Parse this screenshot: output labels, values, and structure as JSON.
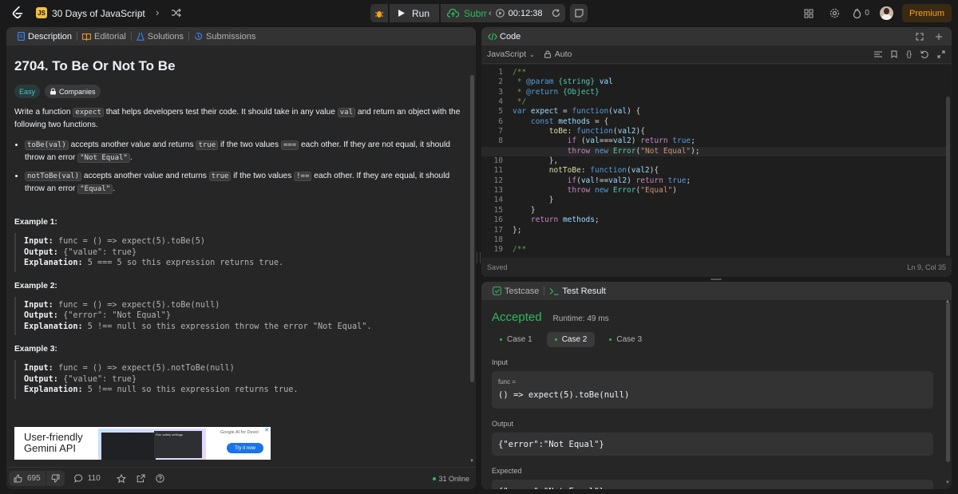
{
  "topbar": {
    "list_badge": "JS",
    "list_title": "30 Days of JavaScript",
    "run": "Run",
    "submit": "Submit",
    "timer": "00:12:38",
    "streak": "0",
    "premium": "Premium"
  },
  "desc_tabs": [
    "Description",
    "Editorial",
    "Solutions",
    "Submissions"
  ],
  "problem": {
    "title": "2704. To Be Or Not To Be",
    "difficulty": "Easy",
    "companies": "Companies",
    "intro_a": "Write a function ",
    "intro_code1": "expect",
    "intro_b": " that helps developers test their code. It should take in any value ",
    "intro_code2": "val",
    "intro_c": " and return an object with the following two functions.",
    "b1_code": "toBe(val)",
    "b1_a": " accepts another value and returns ",
    "b1_true": "true",
    "b1_b": " if the two values ",
    "b1_op": "===",
    "b1_c": " each other. If they are not equal, it should throw an error ",
    "b1_err": "\"Not Equal\"",
    "b1_d": ".",
    "b2_code": "notToBe(val)",
    "b2_a": " accepts another value and returns ",
    "b2_true": "true",
    "b2_b": " if the two values ",
    "b2_op": "!==",
    "b2_c": " each other. If they are equal, it should throw an error ",
    "b2_err": "\"Equal\"",
    "b2_d": ".",
    "examples": [
      {
        "h": "Example 1:",
        "in": "func = () => expect(5).toBe(5)",
        "out": "{\"value\": true}",
        "exp": "5 === 5 so this expression returns true."
      },
      {
        "h": "Example 2:",
        "in": "func = () => expect(5).toBe(null)",
        "out": "{\"error\": \"Not Equal\"}",
        "exp": "5 !== null so this expression throw the error \"Not Equal\"."
      },
      {
        "h": "Example 3:",
        "in": "func = () => expect(5).notToBe(null)",
        "out": "{\"value\": true}",
        "exp": "5 !== null so this expression returns true."
      }
    ],
    "labels": {
      "input": "Input:",
      "output": "Output:",
      "explanation": "Explanation:"
    }
  },
  "ad": {
    "line1": "User-friendly",
    "line2": "Gemini API",
    "mini_title": "Run safety settings",
    "brand": "Google AI for Devel",
    "cta": "Try it now"
  },
  "desc_footer": {
    "likes": "695",
    "comments": "110",
    "online": "31 Online"
  },
  "code": {
    "title": "Code",
    "language": "JavaScript",
    "mode": "Auto",
    "status": "Saved",
    "cursor": "Ln 9, Col 35",
    "line_numbers": [
      "1",
      "2",
      "3",
      "4",
      "5",
      "6",
      "7",
      "8",
      "9",
      "10",
      "11",
      "12",
      "13",
      "14",
      "15",
      "16",
      "17",
      "18",
      "19"
    ]
  },
  "result": {
    "tabs": [
      "Testcase",
      "Test Result"
    ],
    "verdict": "Accepted",
    "runtime": "Runtime: 49 ms",
    "cases": [
      "Case 1",
      "Case 2",
      "Case 3"
    ],
    "input_label": "Input",
    "param": "func =",
    "input_value": "() => expect(5).toBe(null)",
    "output_label": "Output",
    "output_value": "{\"error\":\"Not Equal\"}",
    "expected_label": "Expected",
    "expected_value": "{\"error\":\"Not Equal\"}"
  },
  "colors": {
    "accent": "#ffa116",
    "success": "#2cbb5d",
    "easy": "#46c6c2"
  }
}
